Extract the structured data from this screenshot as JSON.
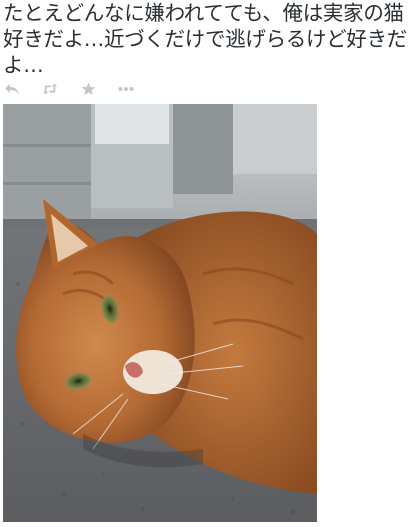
{
  "tweet": {
    "text": "たとえどんなに嫌われてても、俺は実家の猫好きだよ…近づくだけで逃げらるけど好きだよ…"
  },
  "actions": [
    {
      "icon": "reply-icon"
    },
    {
      "icon": "retweet-icon"
    },
    {
      "icon": "favorite-star-icon"
    },
    {
      "icon": "more-dots-icon"
    }
  ],
  "colors": {
    "action_icon": "#b8bec4",
    "text": "#292f33"
  }
}
